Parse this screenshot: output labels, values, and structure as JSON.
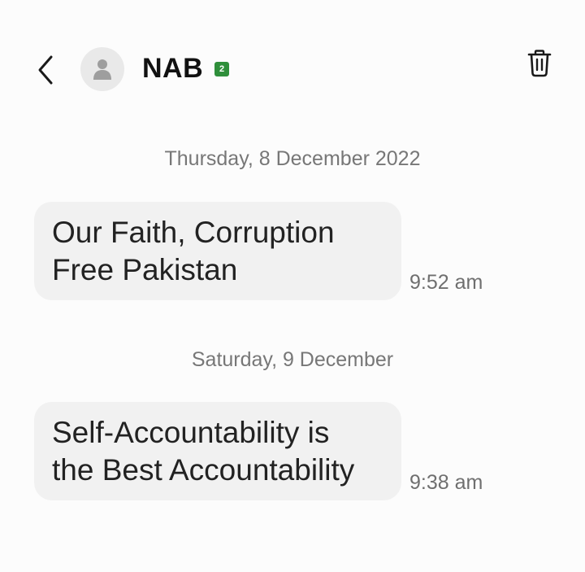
{
  "header": {
    "contact_name": "NAB",
    "sim_badge": "2",
    "icons": {
      "back": "chevron-left-icon",
      "avatar": "person-icon",
      "delete": "trash-icon"
    }
  },
  "conversation": [
    {
      "date": "Thursday, 8 December 2022",
      "message": {
        "lines": [
          "Our Faith, Corruption",
          "Free Pakistan"
        ],
        "time": "9:52 am"
      }
    },
    {
      "date": "Saturday, 9 December",
      "message": {
        "lines": [
          "Self-Accountability is",
          "the Best Accountability"
        ],
        "time": "9:38 am"
      }
    }
  ],
  "colors": {
    "background": "#fcfcfc",
    "bubble": "#f1f1f1",
    "sim_badge": "#2f8f3b",
    "secondary_text": "#777777"
  }
}
